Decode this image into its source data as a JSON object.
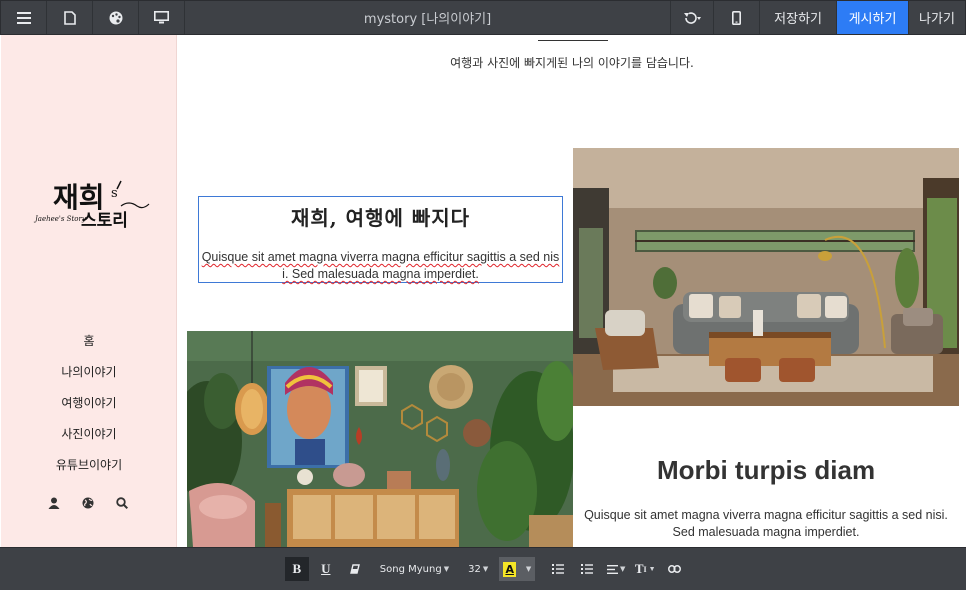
{
  "topbar": {
    "title": "mystory [나의이야기]",
    "save_label": "저장하기",
    "publish_label": "게시하기",
    "exit_label": "나가기",
    "icons": [
      "menu-icon",
      "document-icon",
      "palette-icon",
      "monitor-icon",
      "undo-icon",
      "mobile-icon"
    ],
    "publish_color": "#2d7cf5"
  },
  "sidebar": {
    "background": "#fde9e7",
    "logo": {
      "main": "재희s 스토리",
      "sub": "Jaehee's Story"
    },
    "nav": [
      {
        "label": "홈"
      },
      {
        "label": "나의이야기"
      },
      {
        "label": "여행이야기"
      },
      {
        "label": "사진이야기"
      },
      {
        "label": "유튜브이야기"
      }
    ],
    "icons": [
      "user-icon",
      "globe-icon",
      "search-icon"
    ]
  },
  "content": {
    "tagline": "여행과 사진에 빠지게된 나의 이야기를 담습니다.",
    "block1": {
      "heading": "재희, 여행에 빠지다",
      "body": "Quisque sit amet magna viverra magna efficitur sagittis a sed nisi. Sed malesuada magna imperdiet."
    },
    "block2": {
      "heading": "Morbi turpis diam",
      "body": "Quisque sit amet magna viverra magna efficitur sagittis a sed nisi. Sed malesuada magna imperdiet."
    }
  },
  "bottombar": {
    "bold": "B",
    "underline": "U",
    "font": "Song Myung",
    "size": "32",
    "color_letter": "A",
    "highlight_color": "#f5e626",
    "text_style": "T",
    "icons": [
      "eraser-icon",
      "bullet-list-icon",
      "numbered-list-icon",
      "align-icon",
      "text-size-icon",
      "link-icon"
    ]
  }
}
